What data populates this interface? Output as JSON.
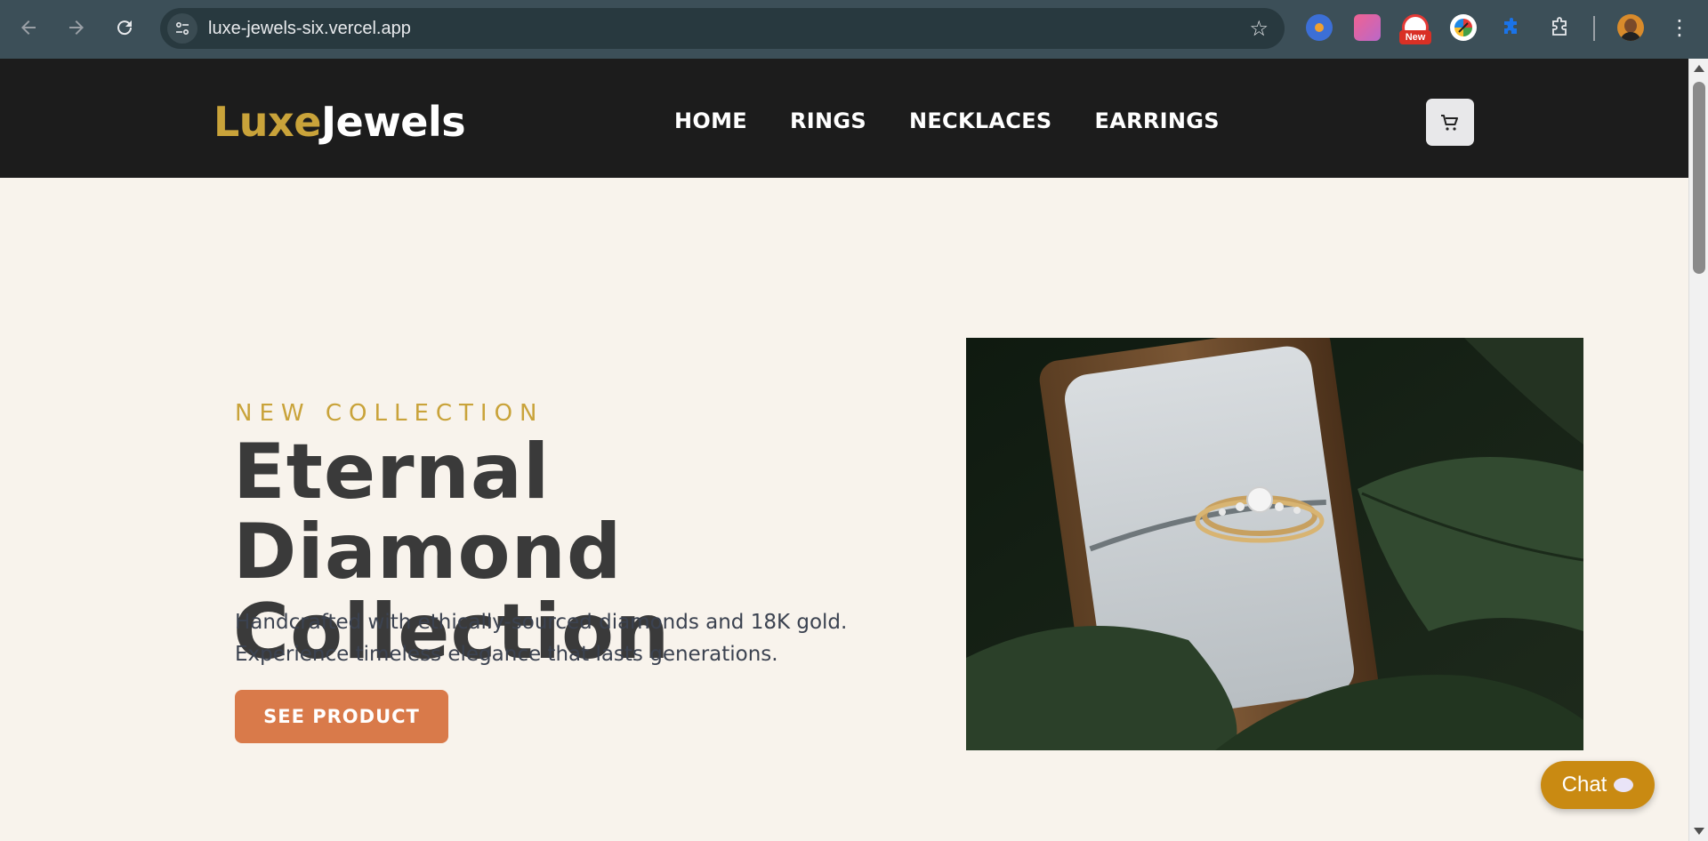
{
  "browser": {
    "url": "luxe-jewels-six.vercel.app",
    "extension_badge": "New"
  },
  "header": {
    "logo_part1": "Luxe",
    "logo_part2": "Jewels",
    "nav": [
      "HOME",
      "RINGS",
      "NECKLACES",
      "EARRINGS"
    ]
  },
  "hero": {
    "eyebrow": "NEW COLLECTION",
    "title_line1": "Eternal Diamond",
    "title_line2": "Collection",
    "desc_line1": "Handcrafted with ethically-sourced diamonds and 18K gold.",
    "desc_line2": "Experience timeless elegance that lasts generations.",
    "cta": "SEE PRODUCT"
  },
  "chat": {
    "label": "Chat"
  },
  "colors": {
    "gold": "#c9a33a",
    "header_bg": "#1c1c1c",
    "page_bg": "#f8f3ec",
    "cta": "#d97a4a",
    "chat": "#c98a12"
  }
}
